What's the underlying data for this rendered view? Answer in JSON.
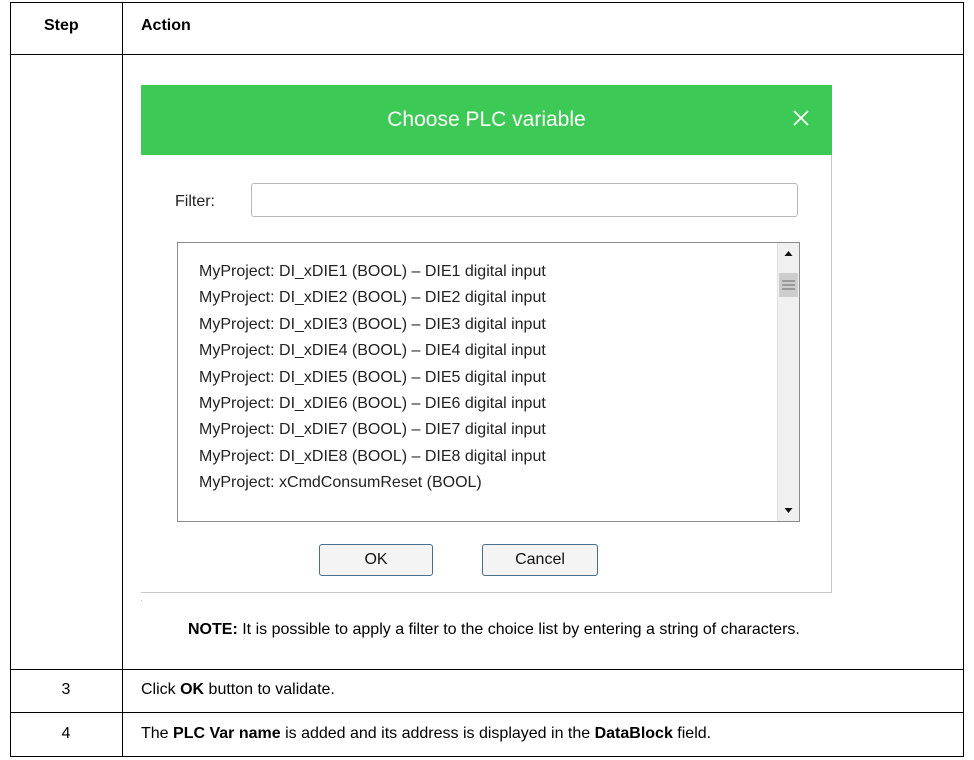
{
  "table": {
    "headers": {
      "step": "Step",
      "action": "Action"
    },
    "rows": [
      {
        "step": "",
        "note_label": "NOTE:",
        "note_text": " It is possible to apply a filter to the choice list by entering a string of characters."
      },
      {
        "step": "3",
        "action_pre": "Click ",
        "action_bold": "OK",
        "action_post": " button to validate."
      },
      {
        "step": "4",
        "action_pre": "The ",
        "action_bold1": "PLC Var name",
        "action_mid": " is added and its address is displayed in the ",
        "action_bold2": "DataBlock",
        "action_post": " field."
      }
    ]
  },
  "dialog": {
    "title": "Choose PLC variable",
    "title_bar_color": "#3dc955",
    "close_icon": "close-icon",
    "filter_label": "Filter:",
    "filter_value": "",
    "variables": [
      "MyProject: DI_xDIE1 (BOOL) – DIE1 digital input",
      "MyProject: DI_xDIE2 (BOOL) – DIE2 digital input",
      "MyProject: DI_xDIE3 (BOOL) – DIE3 digital input",
      "MyProject: DI_xDIE4 (BOOL) – DIE4 digital input",
      "MyProject: DI_xDIE5 (BOOL) – DIE5 digital input",
      "MyProject: DI_xDIE6 (BOOL) – DIE6 digital input",
      "MyProject: DI_xDIE7 (BOOL) – DIE7 digital input",
      "MyProject: DI_xDIE8 (BOOL) – DIE8 digital input",
      "MyProject: xCmdConsumReset (BOOL)"
    ],
    "ok_label": "OK",
    "cancel_label": "Cancel"
  }
}
